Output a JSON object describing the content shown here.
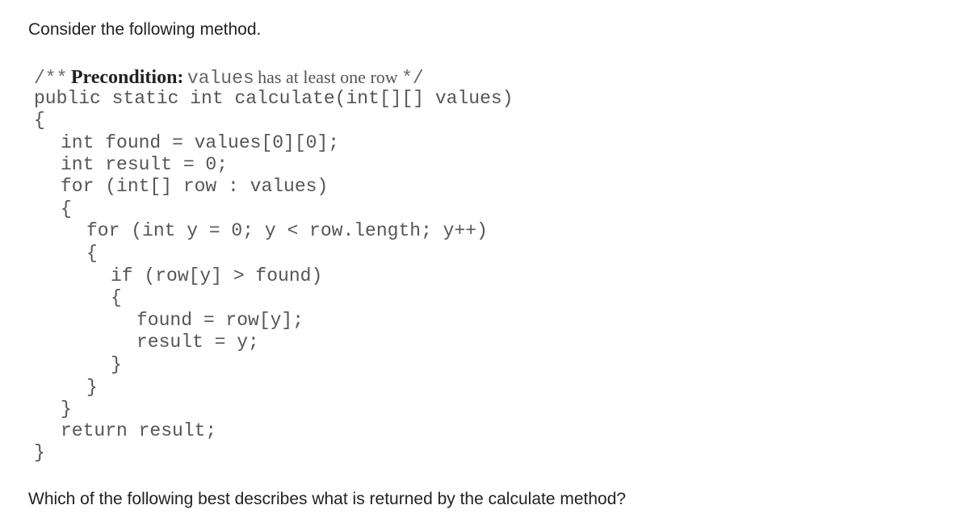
{
  "intro": "Consider the following method.",
  "comment": {
    "open": "/**",
    "label": "Precondition:",
    "var": "values",
    "text": "has at least one row",
    "close": "*/"
  },
  "code_lines": [
    "public static int calculate(int[][] values)",
    "{",
    "int found = values[0][0];",
    "int result = 0;",
    "for (int[] row : values)",
    "{",
    "for (int y = 0; y < row.length; y++)",
    "{",
    "if (row[y] > found)",
    "{",
    "found = row[y];",
    "result = y;",
    "}",
    "}",
    "}",
    "return result;",
    "}"
  ],
  "question": "Which of the following best describes what is returned by the calculate method?"
}
